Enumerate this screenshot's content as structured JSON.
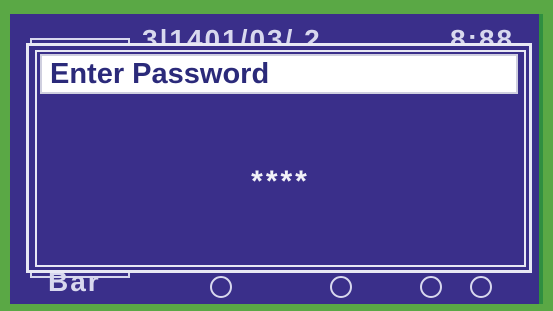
{
  "background_screen": {
    "header_fragment": "3|1401/03/  2",
    "time_fragment": "8:88",
    "footer_fragment": "Bar"
  },
  "dialog": {
    "title": "Enter Password",
    "password_mask": "****"
  }
}
